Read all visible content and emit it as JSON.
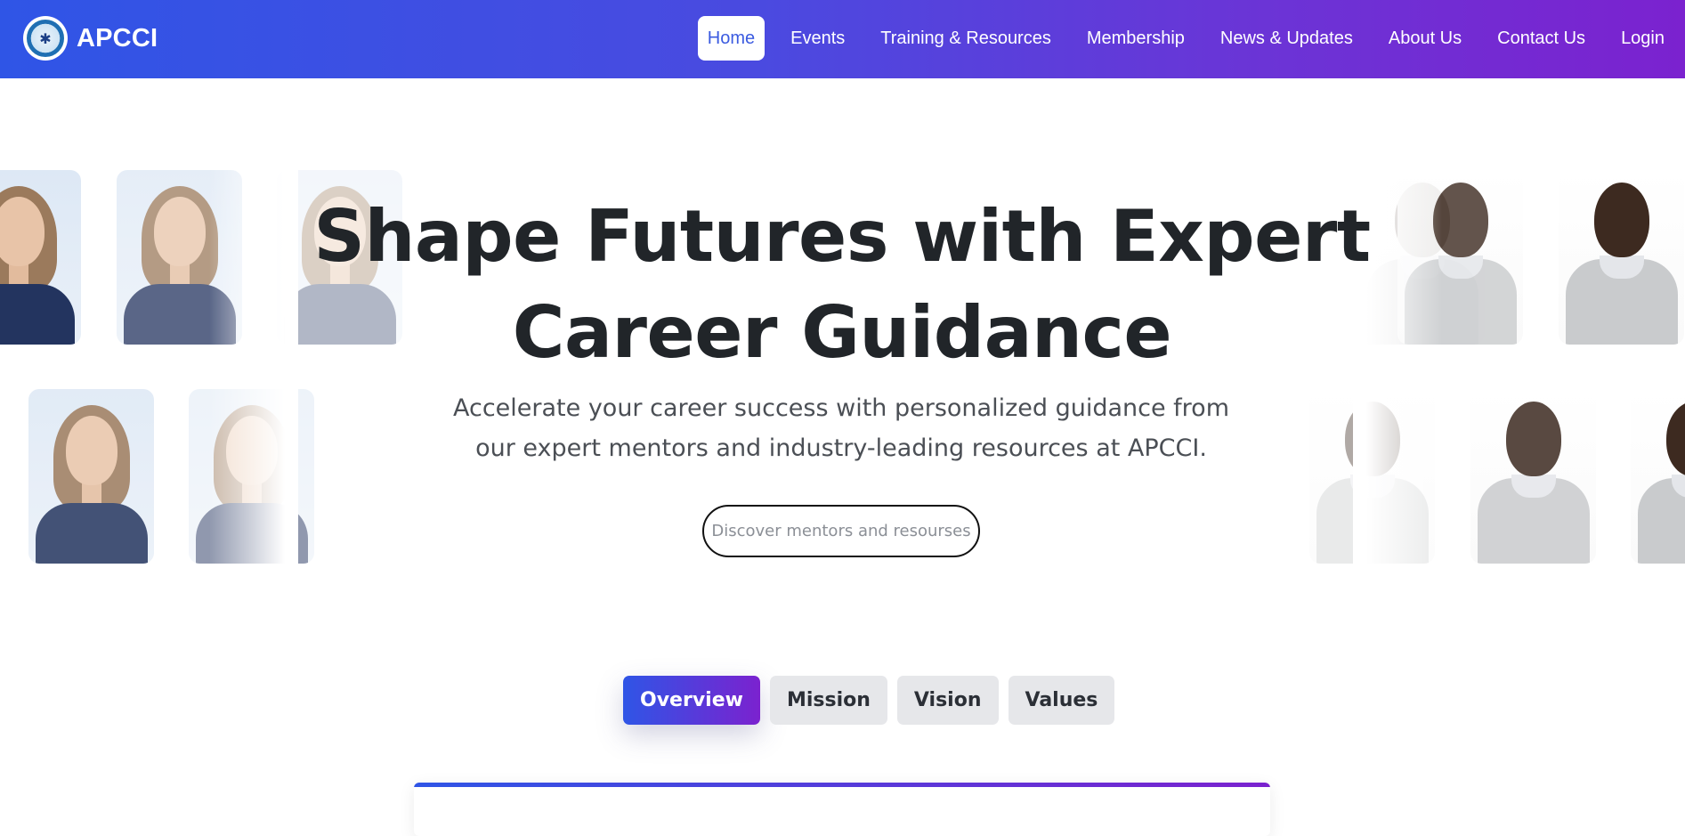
{
  "brand": {
    "name": "APCCI",
    "logo_icon": "apcci-logo-icon"
  },
  "nav": {
    "items": [
      {
        "label": "Home",
        "active": true
      },
      {
        "label": "Events",
        "active": false
      },
      {
        "label": "Training & Resources",
        "active": false
      },
      {
        "label": "Membership",
        "active": false
      },
      {
        "label": "News & Updates",
        "active": false
      },
      {
        "label": "About Us",
        "active": false
      },
      {
        "label": "Contact Us",
        "active": false
      },
      {
        "label": "Login",
        "active": false
      }
    ]
  },
  "hero": {
    "title_line1": "Shape Futures with Expert",
    "title_line2": "Career Guidance",
    "subtitle_line1": "Accelerate your career success with personalized guidance from",
    "subtitle_line2": "our expert mentors and industry-leading resources at APCCI.",
    "search_placeholder": "Discover mentors and resourses"
  },
  "tabs": [
    {
      "label": "Overview",
      "active": true
    },
    {
      "label": "Mission",
      "active": false
    },
    {
      "label": "Vision",
      "active": false
    },
    {
      "label": "Values",
      "active": false
    }
  ],
  "colors": {
    "nav_gradient_start": "#2f55e6",
    "nav_gradient_end": "#7b22cf",
    "active_link": "#3b5be0",
    "title_text": "#212529"
  }
}
